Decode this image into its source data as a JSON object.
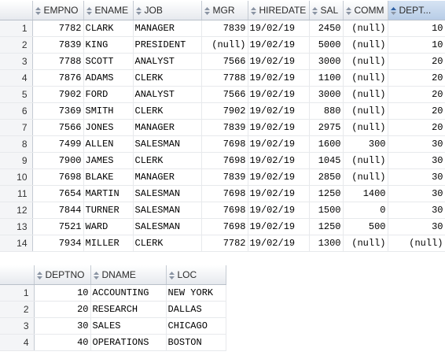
{
  "emp": {
    "columns": [
      "EMPNO",
      "ENAME",
      "JOB",
      "MGR",
      "HIREDATE",
      "SAL",
      "COMM",
      "DEPT..."
    ],
    "rows": [
      [
        "1",
        "7782",
        "CLARK",
        "MANAGER",
        "7839",
        "19/02/19",
        "2450",
        "(null)",
        "10"
      ],
      [
        "2",
        "7839",
        "KING",
        "PRESIDENT",
        "(null)",
        "19/02/19",
        "5000",
        "(null)",
        "10"
      ],
      [
        "3",
        "7788",
        "SCOTT",
        "ANALYST",
        "7566",
        "19/02/19",
        "3000",
        "(null)",
        "20"
      ],
      [
        "4",
        "7876",
        "ADAMS",
        "CLERK",
        "7788",
        "19/02/19",
        "1100",
        "(null)",
        "20"
      ],
      [
        "5",
        "7902",
        "FORD",
        "ANALYST",
        "7566",
        "19/02/19",
        "3000",
        "(null)",
        "20"
      ],
      [
        "6",
        "7369",
        "SMITH",
        "CLERK",
        "7902",
        "19/02/19",
        "880",
        "(null)",
        "20"
      ],
      [
        "7",
        "7566",
        "JONES",
        "MANAGER",
        "7839",
        "19/02/19",
        "2975",
        "(null)",
        "20"
      ],
      [
        "8",
        "7499",
        "ALLEN",
        "SALESMAN",
        "7698",
        "19/02/19",
        "1600",
        "300",
        "30"
      ],
      [
        "9",
        "7900",
        "JAMES",
        "CLERK",
        "7698",
        "19/02/19",
        "1045",
        "(null)",
        "30"
      ],
      [
        "10",
        "7698",
        "BLAKE",
        "MANAGER",
        "7839",
        "19/02/19",
        "2850",
        "(null)",
        "30"
      ],
      [
        "11",
        "7654",
        "MARTIN",
        "SALESMAN",
        "7698",
        "19/02/19",
        "1250",
        "1400",
        "30"
      ],
      [
        "12",
        "7844",
        "TURNER",
        "SALESMAN",
        "7698",
        "19/02/19",
        "1500",
        "0",
        "30"
      ],
      [
        "13",
        "7521",
        "WARD",
        "SALESMAN",
        "7698",
        "19/02/19",
        "1250",
        "500",
        "30"
      ],
      [
        "14",
        "7934",
        "MILLER",
        "CLERK",
        "7782",
        "19/02/19",
        "1300",
        "(null)",
        "(null)"
      ]
    ]
  },
  "dept": {
    "columns": [
      "DEPTNO",
      "DNAME",
      "LOC"
    ],
    "rows": [
      [
        "1",
        "10",
        "ACCOUNTING",
        "NEW YORK"
      ],
      [
        "2",
        "20",
        "RESEARCH",
        "DALLAS"
      ],
      [
        "3",
        "30",
        "SALES",
        "CHICAGO"
      ],
      [
        "4",
        "40",
        "OPERATIONS",
        "BOSTON"
      ]
    ]
  },
  "icons": {
    "column_sort": "sort-arrows-icon",
    "active_sort": "sort-active-icon"
  },
  "colors": {
    "header_bg": "#e6e9ee",
    "active_header_bg": "#b8cde7",
    "grid_line": "#e7e9ec"
  }
}
